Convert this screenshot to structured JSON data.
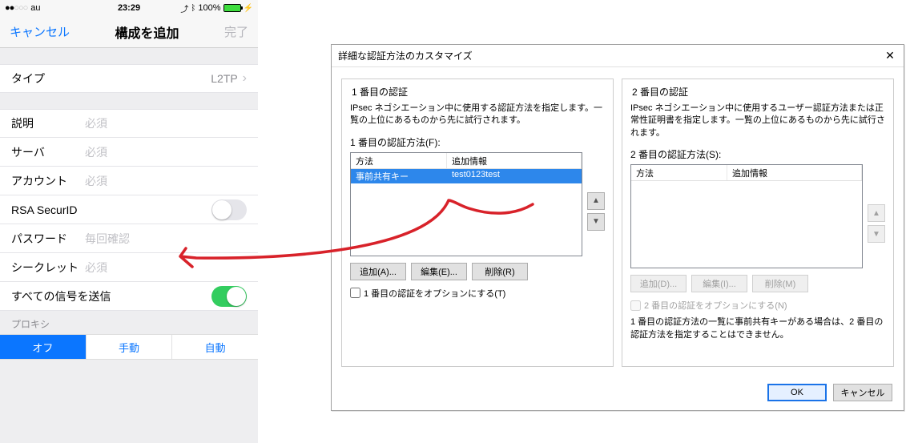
{
  "ios": {
    "status": {
      "carrier": "au",
      "time": "23:29",
      "battery_pct": "100%"
    },
    "nav": {
      "cancel": "キャンセル",
      "title": "構成を追加",
      "done": "完了"
    },
    "type_row": {
      "label": "タイプ",
      "value": "L2TP"
    },
    "rows": {
      "description": {
        "label": "説明",
        "placeholder": "必須"
      },
      "server": {
        "label": "サーバ",
        "placeholder": "必須"
      },
      "account": {
        "label": "アカウント",
        "placeholder": "必須"
      },
      "rsa": {
        "label": "RSA SecurID"
      },
      "password": {
        "label": "パスワード",
        "placeholder": "毎回確認"
      },
      "secret": {
        "label": "シークレット",
        "placeholder": "必須"
      },
      "send_all": {
        "label": "すべての信号を送信"
      }
    },
    "proxy": {
      "label": "プロキシ",
      "off": "オフ",
      "manual": "手動",
      "auto": "自動"
    }
  },
  "win": {
    "title": "詳細な認証方法のカスタマイズ",
    "auth1": {
      "legend": "1 番目の認証",
      "desc": "IPsec ネゴシエーション中に使用する認証方法を指定します。一覧の上位にあるものから先に試行されます。",
      "sub": "1 番目の認証方法(F):",
      "col_method": "方法",
      "col_info": "追加情報",
      "row_method": "事前共有キー",
      "row_info": "test0123test",
      "btn_add": "追加(A)...",
      "btn_edit": "編集(E)...",
      "btn_del": "削除(R)",
      "chk": "1 番目の認証をオプションにする(T)"
    },
    "auth2": {
      "legend": "2 番目の認証",
      "desc": "IPsec ネゴシエーション中に使用するユーザー認証方法または正常性証明書を指定します。一覧の上位にあるものから先に試行されます。",
      "sub": "2 番目の認証方法(S):",
      "col_method": "方法",
      "col_info": "追加情報",
      "btn_add": "追加(D)...",
      "btn_edit": "編集(I)...",
      "btn_del": "削除(M)",
      "chk": "2 番目の認証をオプションにする(N)",
      "note": "1 番目の認証方法の一覧に事前共有キーがある場合は、2 番目の認証方法を指定することはできません。"
    },
    "footer": {
      "ok": "OK",
      "cancel": "キャンセル"
    }
  }
}
